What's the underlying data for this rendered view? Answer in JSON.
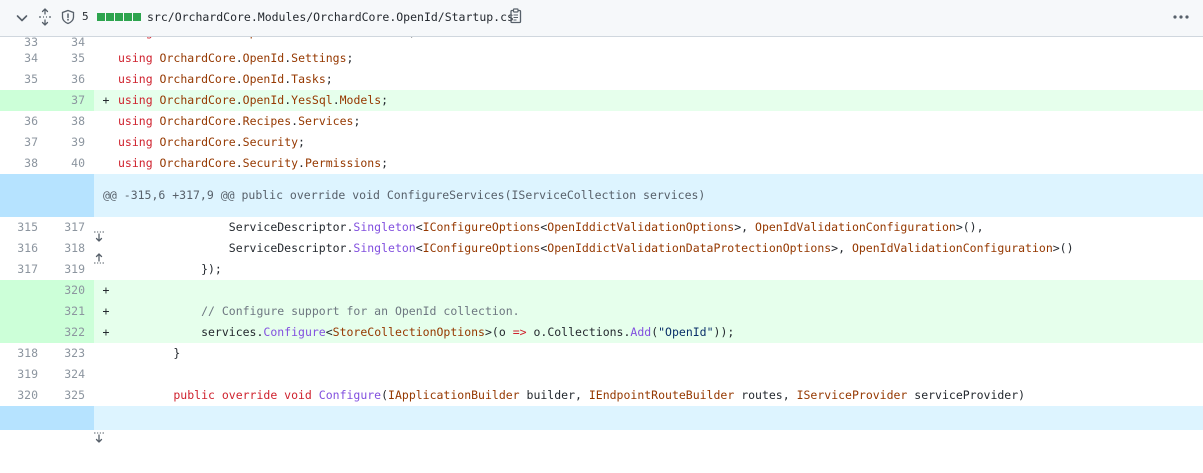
{
  "header": {
    "changes_count": "5",
    "file_path": "src/OrchardCore.Modules/OrchardCore.OpenId/Startup.cs",
    "diffstat_blocks": 5,
    "icons": [
      "chevron-down-icon",
      "unfold-icon",
      "shield-icon",
      "copy-icon",
      "kebab-horizontal-icon"
    ]
  },
  "hunk": {
    "text": "@@ -315,6 +317,9 @@ public override void ConfigureServices(IServiceCollection services)"
  },
  "lines": [
    {
      "old": "34",
      "new": "35",
      "type": "ctx",
      "code": [
        [
          "k",
          "using "
        ],
        [
          "t",
          "OrchardCore"
        ],
        [
          "",
          "."
        ],
        [
          "t",
          "OpenId"
        ],
        [
          "",
          "."
        ],
        [
          "t",
          "Settings"
        ],
        [
          "",
          ";"
        ]
      ]
    },
    {
      "old": "35",
      "new": "36",
      "type": "ctx",
      "code": [
        [
          "k",
          "using "
        ],
        [
          "t",
          "OrchardCore"
        ],
        [
          "",
          "."
        ],
        [
          "t",
          "OpenId"
        ],
        [
          "",
          "."
        ],
        [
          "t",
          "Tasks"
        ],
        [
          "",
          ";"
        ]
      ]
    },
    {
      "old": "",
      "new": "37",
      "type": "add",
      "code": [
        [
          "k",
          "using "
        ],
        [
          "t",
          "OrchardCore"
        ],
        [
          "",
          "."
        ],
        [
          "t",
          "OpenId"
        ],
        [
          "",
          "."
        ],
        [
          "t",
          "YesSql"
        ],
        [
          "",
          "."
        ],
        [
          "t",
          "Models"
        ],
        [
          "",
          ";"
        ]
      ]
    },
    {
      "old": "36",
      "new": "38",
      "type": "ctx",
      "code": [
        [
          "k",
          "using "
        ],
        [
          "t",
          "OrchardCore"
        ],
        [
          "",
          "."
        ],
        [
          "t",
          "Recipes"
        ],
        [
          "",
          "."
        ],
        [
          "t",
          "Services"
        ],
        [
          "",
          ";"
        ]
      ]
    },
    {
      "old": "37",
      "new": "39",
      "type": "ctx",
      "code": [
        [
          "k",
          "using "
        ],
        [
          "t",
          "OrchardCore"
        ],
        [
          "",
          "."
        ],
        [
          "t",
          "Security"
        ],
        [
          "",
          ";"
        ]
      ]
    },
    {
      "old": "38",
      "new": "40",
      "type": "ctx",
      "code": [
        [
          "k",
          "using "
        ],
        [
          "t",
          "OrchardCore"
        ],
        [
          "",
          "."
        ],
        [
          "t",
          "Security"
        ],
        [
          "",
          "."
        ],
        [
          "t",
          "Permissions"
        ],
        [
          "",
          ";"
        ]
      ]
    }
  ],
  "lines2": [
    {
      "old": "315",
      "new": "317",
      "type": "ctx",
      "code": [
        [
          "",
          "                ServiceDescriptor."
        ],
        [
          "f",
          "Singleton"
        ],
        [
          "",
          "<"
        ],
        [
          "t",
          "IConfigureOptions"
        ],
        [
          "",
          "<"
        ],
        [
          "t",
          "OpenIddictValidationOptions"
        ],
        [
          "",
          ">, "
        ],
        [
          "t",
          "OpenIdValidationConfiguration"
        ],
        [
          "",
          ">(),"
        ]
      ]
    },
    {
      "old": "316",
      "new": "318",
      "type": "ctx",
      "code": [
        [
          "",
          "                ServiceDescriptor."
        ],
        [
          "f",
          "Singleton"
        ],
        [
          "",
          "<"
        ],
        [
          "t",
          "IConfigureOptions"
        ],
        [
          "",
          "<"
        ],
        [
          "t",
          "OpenIddictValidationDataProtectionOptions"
        ],
        [
          "",
          ">, "
        ],
        [
          "t",
          "OpenIdValidationConfiguration"
        ],
        [
          "",
          ">()"
        ]
      ]
    },
    {
      "old": "317",
      "new": "319",
      "type": "ctx",
      "code": [
        [
          "",
          "            });"
        ]
      ]
    },
    {
      "old": "",
      "new": "320",
      "type": "add",
      "code": [
        [
          "",
          ""
        ]
      ]
    },
    {
      "old": "",
      "new": "321",
      "type": "add",
      "code": [
        [
          "c",
          "            // Configure support for an OpenId collection."
        ]
      ]
    },
    {
      "old": "",
      "new": "322",
      "type": "add",
      "code": [
        [
          "",
          "            services."
        ],
        [
          "f",
          "Configure"
        ],
        [
          "",
          "<"
        ],
        [
          "t",
          "StoreCollectionOptions"
        ],
        [
          "",
          ">(o "
        ],
        [
          "k",
          "=>"
        ],
        [
          "",
          " o.Collections."
        ],
        [
          "f",
          "Add"
        ],
        [
          "",
          "("
        ],
        [
          "s",
          "\"OpenId\""
        ],
        [
          "",
          "));"
        ]
      ]
    },
    {
      "old": "318",
      "new": "323",
      "type": "ctx",
      "code": [
        [
          "",
          "        }"
        ]
      ]
    },
    {
      "old": "319",
      "new": "324",
      "type": "ctx",
      "code": [
        [
          "",
          ""
        ]
      ]
    },
    {
      "old": "320",
      "new": "325",
      "type": "ctx",
      "code": [
        [
          "k",
          "        public override void "
        ],
        [
          "f",
          "Configure"
        ],
        [
          "",
          "("
        ],
        [
          "t",
          "IApplicationBuilder"
        ],
        [
          "",
          " builder, "
        ],
        [
          "t",
          "IEndpointRouteBuilder"
        ],
        [
          "",
          " routes, "
        ],
        [
          "t",
          "IServiceProvider"
        ],
        [
          "",
          " serviceProvider)"
        ]
      ]
    }
  ],
  "partial_top": {
    "old": "33",
    "new": "34",
    "code": [
      [
        "k",
        "using "
      ],
      [
        "t",
        "OrchardCore"
      ],
      [
        "",
        "."
      ],
      [
        "t",
        "OpenId"
      ],
      [
        "",
        "."
      ],
      [
        "t",
        "Services"
      ],
      [
        "",
        "."
      ],
      [
        "t",
        "Handlers"
      ],
      [
        "",
        ";"
      ]
    ]
  }
}
